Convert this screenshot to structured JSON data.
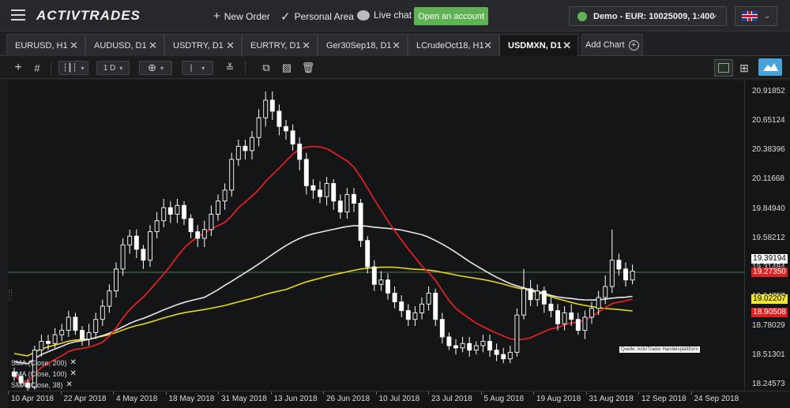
{
  "topbar": {
    "brand": "ACTIVTRADES",
    "new_order": "New Order",
    "personal_area": "Personal Area",
    "live_chat": "Live chat",
    "open_account": "Open an account",
    "account": "Demo - EUR: 10025009, 1:400",
    "language_icon": "uk-flag-icon"
  },
  "tabs": [
    {
      "label": "EURUSD, H1"
    },
    {
      "label": "AUDUSD, D1"
    },
    {
      "label": "USDTRY, D1"
    },
    {
      "label": "EURTRY, D1"
    },
    {
      "label": "Ger30Sep18, D1"
    },
    {
      "label": "LCrudeOct18, H1"
    },
    {
      "label": "USDMXN, D1",
      "active": true
    }
  ],
  "add_chart": "Add Chart",
  "toolbar": {
    "timeframe": "1 D",
    "icons": [
      "crosshair-icon",
      "grid-icon",
      "candlestick-icon",
      "add-indicator-icon",
      "line-tool-icon",
      "fibonacci-icon",
      "screenshot-icon",
      "trash-icon",
      "single-layout-icon",
      "quad-layout-icon",
      "cloud-icon"
    ]
  },
  "colors": {
    "candle": "#ffffff",
    "sma200": "#e8e8e8",
    "sma100": "#e8d81a",
    "sma38": "#e02020",
    "hline": "#5a7a4a",
    "accent": "#5fb354"
  },
  "chart": {
    "symbol": "USDMXN",
    "source_label": "Quelle: ActivTrader Handelsplattform",
    "legend": [
      "SMA (Close, 200)",
      "SMA (Close, 100)",
      "SMA (Close, 38)"
    ]
  },
  "chart_data": {
    "type": "candlestick",
    "y_ticks": [
      "20.91852",
      "20.65124",
      "20.38396",
      "20.11668",
      "19.84940",
      "19.58212",
      "19.31484",
      "19.04757",
      "18.78029",
      "18.51301",
      "18.24573"
    ],
    "x_ticks": [
      "10 Apr 2018",
      "22 Apr 2018",
      "4 May 2018",
      "18 May 2018",
      "31 May 2018",
      "13 Jun 2018",
      "26 Jun 2018",
      "10 Jul 2018",
      "23 Jul 2018",
      "5 Aug 2018",
      "19 Aug 2018",
      "31 Aug 2018",
      "12 Sep 2018",
      "24 Sep 2018"
    ],
    "ylim": [
      18.19,
      21.02
    ],
    "price_tags": [
      {
        "label": "19.39194",
        "value": 19.39194,
        "bg": "#ffffff",
        "fg": "#000000"
      },
      {
        "label": "19.27350",
        "value": 19.2735,
        "bg": "#e02020",
        "fg": "#ffffff"
      },
      {
        "label": "19.02207",
        "value": 19.02207,
        "bg": "#f2e82a",
        "fg": "#000000"
      },
      {
        "label": "18.90508",
        "value": 18.90508,
        "bg": "#e02020",
        "fg": "#ffffff"
      }
    ],
    "horizontal_line": 19.27,
    "candles": [
      [
        18.36,
        18.32,
        18.4,
        18.28
      ],
      [
        18.32,
        18.26,
        18.35,
        18.22
      ],
      [
        18.26,
        18.22,
        18.3,
        18.18
      ],
      [
        18.22,
        18.56,
        18.6,
        18.2
      ],
      [
        18.56,
        18.64,
        18.7,
        18.5
      ],
      [
        18.64,
        18.62,
        18.7,
        18.56
      ],
      [
        18.62,
        18.7,
        18.76,
        18.58
      ],
      [
        18.7,
        18.74,
        18.8,
        18.64
      ],
      [
        18.74,
        18.86,
        18.92,
        18.68
      ],
      [
        18.86,
        18.74,
        18.9,
        18.7
      ],
      [
        18.74,
        18.66,
        18.78,
        18.6
      ],
      [
        18.66,
        18.72,
        18.8,
        18.6
      ],
      [
        18.72,
        18.84,
        18.9,
        18.66
      ],
      [
        18.84,
        18.96,
        19.02,
        18.78
      ],
      [
        18.96,
        19.1,
        19.16,
        18.9
      ],
      [
        19.1,
        19.3,
        19.36,
        19.04
      ],
      [
        19.3,
        19.52,
        19.58,
        19.24
      ],
      [
        19.52,
        19.6,
        19.66,
        19.44
      ],
      [
        19.6,
        19.48,
        19.66,
        19.4
      ],
      [
        19.48,
        19.38,
        19.52,
        19.3
      ],
      [
        19.38,
        19.64,
        19.7,
        19.32
      ],
      [
        19.64,
        19.74,
        19.82,
        19.58
      ],
      [
        19.74,
        19.86,
        19.94,
        19.68
      ],
      [
        19.86,
        19.8,
        19.92,
        19.72
      ],
      [
        19.8,
        19.88,
        19.94,
        19.72
      ],
      [
        19.88,
        19.76,
        19.92,
        19.7
      ],
      [
        19.76,
        19.64,
        19.8,
        19.58
      ],
      [
        19.64,
        19.58,
        19.7,
        19.5
      ],
      [
        19.58,
        19.66,
        19.74,
        19.5
      ],
      [
        19.66,
        19.8,
        19.88,
        19.6
      ],
      [
        19.8,
        19.92,
        19.98,
        19.74
      ],
      [
        19.92,
        20.02,
        20.08,
        19.84
      ],
      [
        20.02,
        20.3,
        20.36,
        19.96
      ],
      [
        20.3,
        20.42,
        20.48,
        20.24
      ],
      [
        20.42,
        20.38,
        20.48,
        20.3
      ],
      [
        20.38,
        20.5,
        20.56,
        20.3
      ],
      [
        20.5,
        20.68,
        20.76,
        20.42
      ],
      [
        20.68,
        20.84,
        20.92,
        20.6
      ],
      [
        20.84,
        20.74,
        20.92,
        20.66
      ],
      [
        20.74,
        20.6,
        20.8,
        20.52
      ],
      [
        20.6,
        20.56,
        20.66,
        20.48
      ],
      [
        20.56,
        20.44,
        20.62,
        20.38
      ],
      [
        20.44,
        20.3,
        20.5,
        20.2
      ],
      [
        20.3,
        20.06,
        20.36,
        19.98
      ],
      [
        20.06,
        20.02,
        20.12,
        19.94
      ],
      [
        20.02,
        19.96,
        20.1,
        19.9
      ],
      [
        19.96,
        20.08,
        20.14,
        19.88
      ],
      [
        20.08,
        19.92,
        20.12,
        19.84
      ],
      [
        19.92,
        19.82,
        19.98,
        19.76
      ],
      [
        19.82,
        19.98,
        20.04,
        19.76
      ],
      [
        19.98,
        19.9,
        20.04,
        19.82
      ],
      [
        19.9,
        19.56,
        19.94,
        19.5
      ],
      [
        19.56,
        19.32,
        19.6,
        19.26
      ],
      [
        19.32,
        19.16,
        19.38,
        19.1
      ],
      [
        19.16,
        19.2,
        19.28,
        19.1
      ],
      [
        19.2,
        19.08,
        19.26,
        19.02
      ],
      [
        19.08,
        19.0,
        19.14,
        18.94
      ],
      [
        19.0,
        18.92,
        19.06,
        18.86
      ],
      [
        18.92,
        18.84,
        18.98,
        18.78
      ],
      [
        18.84,
        18.9,
        18.96,
        18.78
      ],
      [
        18.9,
        18.98,
        19.04,
        18.84
      ],
      [
        18.98,
        19.08,
        19.14,
        18.92
      ],
      [
        19.08,
        18.84,
        19.12,
        18.78
      ],
      [
        18.84,
        18.68,
        18.9,
        18.62
      ],
      [
        18.68,
        18.6,
        18.72,
        18.56
      ],
      [
        18.6,
        18.58,
        18.66,
        18.52
      ],
      [
        18.58,
        18.62,
        18.68,
        18.54
      ],
      [
        18.62,
        18.56,
        18.68,
        18.5
      ],
      [
        18.56,
        18.6,
        18.64,
        18.52
      ],
      [
        18.6,
        18.64,
        18.7,
        18.54
      ],
      [
        18.64,
        18.56,
        18.7,
        18.5
      ],
      [
        18.56,
        18.52,
        18.62,
        18.46
      ],
      [
        18.52,
        18.48,
        18.58,
        18.44
      ],
      [
        18.48,
        18.54,
        18.6,
        18.44
      ],
      [
        18.54,
        18.88,
        18.94,
        18.5
      ],
      [
        18.88,
        19.12,
        19.3,
        18.84
      ],
      [
        19.12,
        19.02,
        19.2,
        18.96
      ],
      [
        19.02,
        19.1,
        19.16,
        18.96
      ],
      [
        19.1,
        18.98,
        19.14,
        18.9
      ],
      [
        18.98,
        18.92,
        19.04,
        18.86
      ],
      [
        18.92,
        18.8,
        18.98,
        18.74
      ],
      [
        18.8,
        18.9,
        18.96,
        18.74
      ],
      [
        18.9,
        18.84,
        18.98,
        18.78
      ],
      [
        18.84,
        18.74,
        18.9,
        18.7
      ],
      [
        18.74,
        18.86,
        18.92,
        18.66
      ],
      [
        18.86,
        18.94,
        19.0,
        18.8
      ],
      [
        18.94,
        19.04,
        19.1,
        18.88
      ],
      [
        19.04,
        19.14,
        19.24,
        18.98
      ],
      [
        19.14,
        19.38,
        19.66,
        19.08
      ],
      [
        19.38,
        19.3,
        19.44,
        19.24
      ],
      [
        19.3,
        19.2,
        19.36,
        19.14
      ],
      [
        19.2,
        19.28,
        19.34,
        19.16
      ]
    ]
  }
}
